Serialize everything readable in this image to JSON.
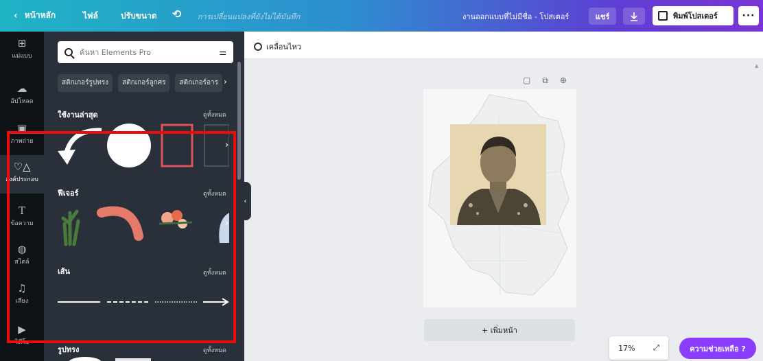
{
  "topbar": {
    "back_label": "หน้าหลัก",
    "file_label": "ไฟล์",
    "resize_label": "ปรับขนาด",
    "unsaved_text": "การเปลี่ยนแปลงที่ยังไม่ได้บันทึก",
    "doc_title": "งานออกแบบที่ไม่มีชื่อ - โปสเตอร์",
    "share_label": "แชร์",
    "print_label": "พิมพ์โปสเตอร์",
    "more_label": "···"
  },
  "rail": {
    "items": [
      {
        "label": "แม่แบบ",
        "icon": "template-icon"
      },
      {
        "label": "อัปโหลด",
        "icon": "upload-icon"
      },
      {
        "label": "ภาพถ่าย",
        "icon": "photo-icon"
      },
      {
        "label": "องค์ประกอบ",
        "icon": "elements-icon"
      },
      {
        "label": "ข้อความ",
        "icon": "text-icon"
      },
      {
        "label": "สไตล์",
        "icon": "palette-icon"
      },
      {
        "label": "เสียง",
        "icon": "music-icon"
      },
      {
        "label": "วิดีโอ",
        "icon": "video-icon"
      }
    ],
    "active_index": 3
  },
  "panel": {
    "search_placeholder": "ค้นหา Elements Pro",
    "chips": [
      "สติกเกอร์รูปทรง",
      "สติกเกอร์ลูกศร",
      "สติกเกอร์อาร"
    ],
    "sections": [
      {
        "title": "ใช้งานล่าสุด",
        "see_all": "ดูทั้งหมด"
      },
      {
        "title": "ฟีเจอร์",
        "see_all": "ดูทั้งหมด"
      },
      {
        "title": "เส้น",
        "see_all": "ดูทั้งหมด"
      },
      {
        "title": "รูปทรง",
        "see_all": "ดูทั้งหมด"
      }
    ]
  },
  "canvas": {
    "animate_label": "เคลื่อนไหว",
    "add_page_label": "+ เพิ่มหน้า",
    "zoom_value": "17%",
    "help_label": "ความช่วยเหลือ ?"
  },
  "colors": {
    "highlight": "#ee0b0b",
    "accent": "#8b3dff",
    "panel_bg": "#293039",
    "rail_bg": "#0e1318"
  }
}
